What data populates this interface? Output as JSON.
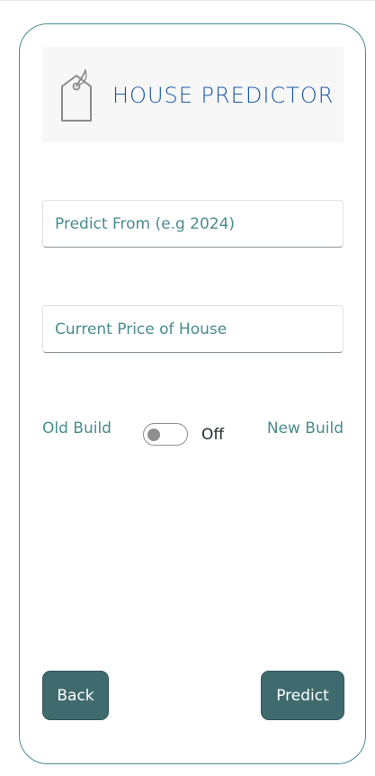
{
  "logo": {
    "title": "HOUSE PREDICTOR",
    "icon": "price-tag-icon",
    "icon_color": "#8a8a8a",
    "text_color": "#1b57a8"
  },
  "form": {
    "year_placeholder": "Predict From (e.g 2024)",
    "price_placeholder": "Current Price of House",
    "old_build_label": "Old Build",
    "new_build_label": "New Build",
    "toggle_state": "Off"
  },
  "actions": {
    "back_label": "Back",
    "predict_label": "Predict"
  },
  "colors": {
    "accent": "#4a8c8f",
    "button": "#3f6b6e"
  }
}
